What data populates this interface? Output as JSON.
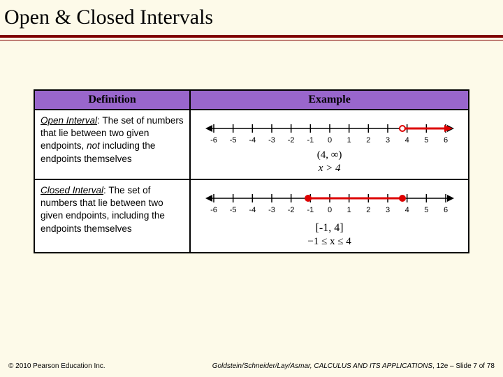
{
  "title": "Open & Closed Intervals",
  "headers": {
    "definition": "Definition",
    "example": "Example"
  },
  "rows": {
    "open": {
      "term": "Open Interval",
      "colon": ":",
      "body_1": "  The set of numbers that lie between two given endpoints, ",
      "not": "not",
      "body_2": " including the endpoints themselves",
      "interval_notation": "(4, ∞)",
      "inequality": "x > 4"
    },
    "closed": {
      "term": "Closed Interval",
      "colon": ":",
      "body": "  The set of numbers that lie between two given endpoints, including the endpoints themselves",
      "interval_notation": "[-1, 4]",
      "inequality": "−1 ≤ x ≤ 4"
    }
  },
  "ticks": [
    "-6",
    "-5",
    "-4",
    "-3",
    "-2",
    "-1",
    "0",
    "1",
    "2",
    "3",
    "4",
    "5",
    "6"
  ],
  "footer": {
    "left": "© 2010 Pearson Education Inc.",
    "right_italic": "Goldstein/Schneider/Lay/Asmar, CALCULUS AND ITS APPLICATIONS",
    "right_plain": ", 12e – Slide 7 of 78"
  },
  "chart_data": [
    {
      "type": "line",
      "title": "Open interval (4, ∞)",
      "x": [
        -6,
        -5,
        -4,
        -3,
        -2,
        -1,
        0,
        1,
        2,
        3,
        4,
        5,
        6
      ],
      "xlabel": "",
      "ylabel": "",
      "interval_start": 4,
      "interval_end": null,
      "start_included": false,
      "end_included": false,
      "ray_direction": "right"
    },
    {
      "type": "line",
      "title": "Closed interval [-1, 4]",
      "x": [
        -6,
        -5,
        -4,
        -3,
        -2,
        -1,
        0,
        1,
        2,
        3,
        4,
        5,
        6
      ],
      "xlabel": "",
      "ylabel": "",
      "interval_start": -1,
      "interval_end": 4,
      "start_included": true,
      "end_included": true
    }
  ]
}
